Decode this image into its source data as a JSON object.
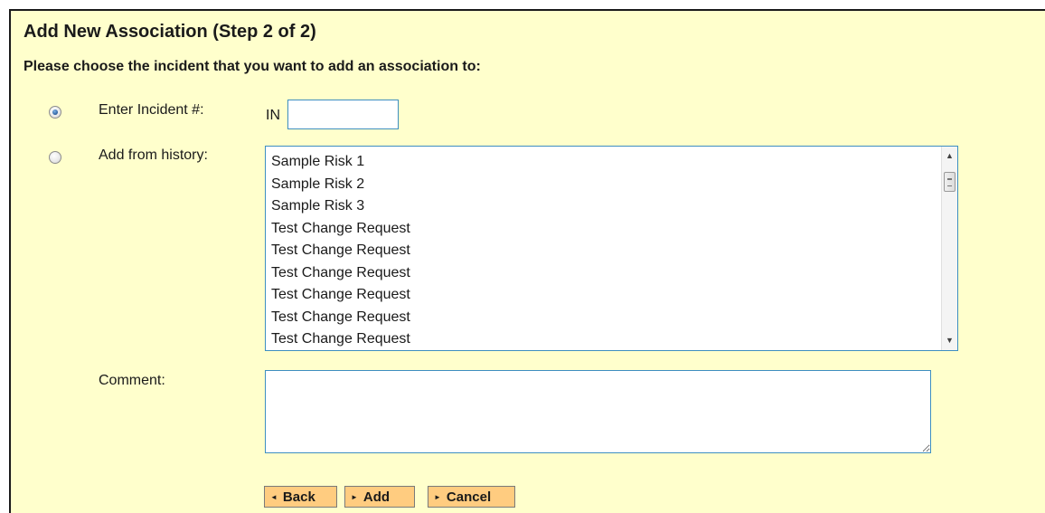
{
  "title": "Add New Association (Step 2 of 2)",
  "subtitle": "Please choose the incident that you want to add an association to:",
  "options": {
    "enter_incident": {
      "label": "Enter Incident #:",
      "prefix": "IN",
      "value": "",
      "checked": true
    },
    "history": {
      "label": "Add from history:",
      "checked": false,
      "items": [
        "Sample Risk 1",
        "Sample Risk 2",
        "Sample Risk 3",
        "Test Change Request",
        "Test Change Request",
        "Test Change Request",
        "Test Change Request",
        "Test Change Request",
        "Test Change Request"
      ]
    }
  },
  "comment": {
    "label": "Comment:",
    "value": ""
  },
  "buttons": {
    "back": "Back",
    "add": "Add",
    "cancel": "Cancel"
  },
  "icons": {
    "back": "arrow-left-icon",
    "add": "arrow-right-icon",
    "cancel": "arrow-right-icon"
  },
  "colors": {
    "panel_bg": "#ffffcc",
    "button_bg": "#ffcc80",
    "input_border": "#3d8ec0"
  }
}
